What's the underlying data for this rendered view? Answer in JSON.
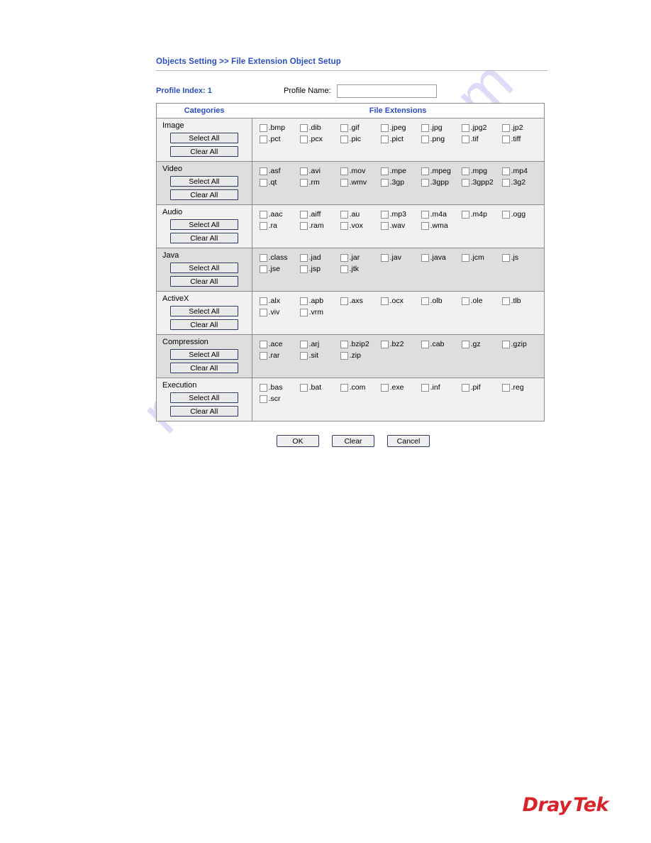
{
  "page": {
    "title": "Objects Setting >> File Extension Object Setup",
    "accent_blue": "#2b4ec4",
    "logo_red": "#d8232a",
    "watermark": "manualshive.com"
  },
  "profile": {
    "index_label": "Profile Index: 1",
    "name_label": "Profile Name:",
    "name_value": "",
    "name_placeholder": ""
  },
  "table": {
    "header_categories": "Categories",
    "header_extensions": "File Extensions",
    "select_all_label": "Select All",
    "clear_all_label": "Clear All",
    "sections": [
      {
        "name": "Image",
        "shade": "light",
        "extensions": [
          ".bmp",
          ".dib",
          ".gif",
          ".jpeg",
          ".jpg",
          ".jpg2",
          ".jp2",
          ".pct",
          ".pcx",
          ".pic",
          ".pict",
          ".png",
          ".tif",
          ".tiff"
        ]
      },
      {
        "name": "Video",
        "shade": "dark",
        "extensions": [
          ".asf",
          ".avi",
          ".mov",
          ".mpe",
          ".mpeg",
          ".mpg",
          ".mp4",
          ".qt",
          ".rm",
          ".wmv",
          ".3gp",
          ".3gpp",
          ".3gpp2",
          ".3g2"
        ]
      },
      {
        "name": "Audio",
        "shade": "light",
        "extensions": [
          ".aac",
          ".aiff",
          ".au",
          ".mp3",
          ".m4a",
          ".m4p",
          ".ogg",
          ".ra",
          ".ram",
          ".vox",
          ".wav",
          ".wma"
        ]
      },
      {
        "name": "Java",
        "shade": "dark",
        "extensions": [
          ".class",
          ".jad",
          ".jar",
          ".jav",
          ".java",
          ".jcm",
          ".js",
          ".jse",
          ".jsp",
          ".jtk"
        ]
      },
      {
        "name": "ActiveX",
        "shade": "light",
        "extensions": [
          ".alx",
          ".apb",
          ".axs",
          ".ocx",
          ".olb",
          ".ole",
          ".tlb",
          ".viv",
          ".vrm"
        ]
      },
      {
        "name": "Compression",
        "shade": "dark",
        "extensions": [
          ".ace",
          ".arj",
          ".bzip2",
          ".bz2",
          ".cab",
          ".gz",
          ".gzip",
          ".rar",
          ".sit",
          ".zip"
        ]
      },
      {
        "name": "Execution",
        "shade": "light",
        "extensions": [
          ".bas",
          ".bat",
          ".com",
          ".exe",
          ".inf",
          ".pif",
          ".reg",
          ".scr"
        ]
      }
    ]
  },
  "footer": {
    "ok_label": "OK",
    "clear_label": "Clear",
    "cancel_label": "Cancel"
  },
  "logo": {
    "dray": "Dray",
    "tek": "Tek"
  }
}
